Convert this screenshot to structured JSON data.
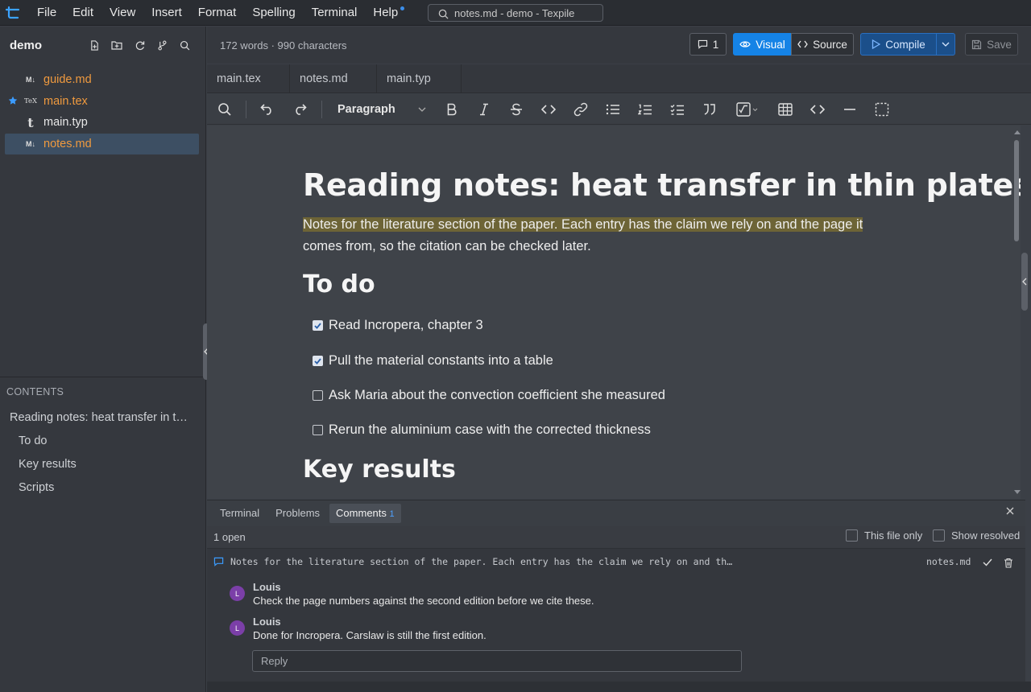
{
  "menubar": {
    "items": [
      "File",
      "Edit",
      "View",
      "Insert",
      "Format",
      "Spelling",
      "Terminal",
      "Help"
    ],
    "window_title": "notes.md - demo - Texpile"
  },
  "sidebar": {
    "project_name": "demo",
    "files": [
      {
        "icon": "M↓",
        "name": "guide.md",
        "modified": true,
        "starred": false,
        "active": false
      },
      {
        "icon": "TeX",
        "name": "main.tex",
        "modified": true,
        "starred": true,
        "active": false
      },
      {
        "icon": "t",
        "name": "main.typ",
        "modified": false,
        "starred": false,
        "active": false
      },
      {
        "icon": "M↓",
        "name": "notes.md",
        "modified": true,
        "starred": false,
        "active": true
      }
    ],
    "contents_label": "CONTENTS",
    "toc": [
      {
        "label": "Reading notes: heat transfer in thin plates",
        "level": 1
      },
      {
        "label": "To do",
        "level": 2
      },
      {
        "label": "Key results",
        "level": 2
      },
      {
        "label": "Scripts",
        "level": 2
      }
    ]
  },
  "topbar": {
    "word_count": "172 words · 990 characters",
    "comments_count": "1",
    "visual_label": "Visual",
    "source_label": "Source",
    "compile_label": "Compile",
    "save_label": "Save"
  },
  "tabs": [
    "main.tex",
    "notes.md",
    "main.typ"
  ],
  "toolbar": {
    "paragraph_style": "Paragraph"
  },
  "document": {
    "title": "Reading notes: heat transfer in thin plates",
    "intro_highlighted": "Notes for the literature section of the paper. Each entry has the claim we rely on and the page it",
    "intro_rest": "comes from, so the citation can be checked later.",
    "todo_heading": "To do",
    "tasks": [
      {
        "text": "Read Incropera, chapter 3",
        "checked": true
      },
      {
        "text": "Pull the material constants into a table",
        "checked": true
      },
      {
        "text": "Ask Maria about the convection coefficient she measured",
        "checked": false
      },
      {
        "text": "Rerun the aluminium case with the corrected thickness",
        "checked": false
      }
    ],
    "results_heading": "Key results"
  },
  "panel": {
    "tabs": [
      "Terminal",
      "Problems",
      "Comments"
    ],
    "comments_badge": "1",
    "open_count": "1 open",
    "filter_this_file": "This file only",
    "filter_show_resolved": "Show resolved",
    "comment": {
      "excerpt": "Notes for the literature section of the paper. Each entry has the claim we rely on and th…",
      "file": "notes.md",
      "replies": [
        {
          "initial": "L",
          "author": "Louis",
          "text": "Check the page numbers against the second edition before we cite these."
        },
        {
          "initial": "L",
          "author": "Louis",
          "text": "Done for Incropera. Carslaw is still the first edition."
        }
      ],
      "reply_placeholder": "Reply"
    }
  },
  "colors": {
    "accent": "#1a7fd9",
    "modified_file": "#f09a3e",
    "highlight": "#6d6436",
    "avatar": "#7b3fa8"
  }
}
